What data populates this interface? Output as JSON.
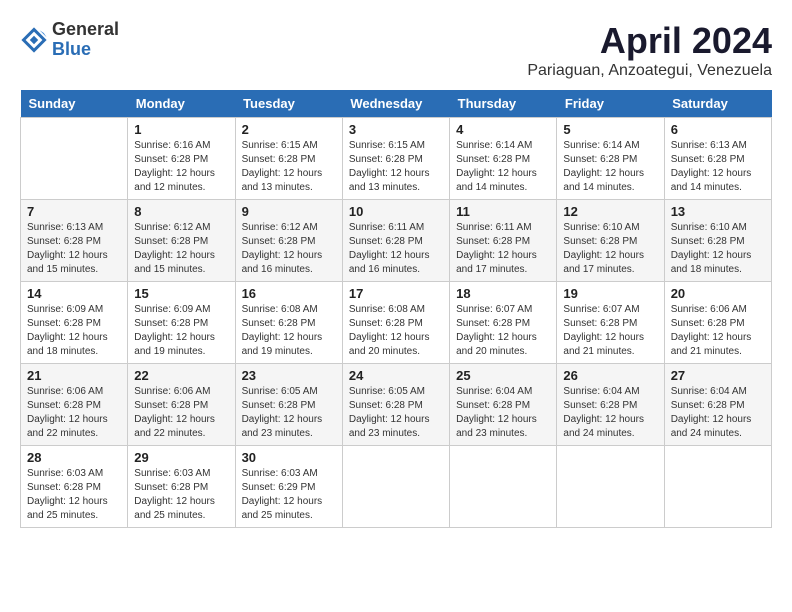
{
  "logo": {
    "general": "General",
    "blue": "Blue"
  },
  "title": "April 2024",
  "location": "Pariaguan, Anzoategui, Venezuela",
  "days_of_week": [
    "Sunday",
    "Monday",
    "Tuesday",
    "Wednesday",
    "Thursday",
    "Friday",
    "Saturday"
  ],
  "weeks": [
    [
      {
        "day": "",
        "info": ""
      },
      {
        "day": "1",
        "info": "Sunrise: 6:16 AM\nSunset: 6:28 PM\nDaylight: 12 hours\nand 12 minutes."
      },
      {
        "day": "2",
        "info": "Sunrise: 6:15 AM\nSunset: 6:28 PM\nDaylight: 12 hours\nand 13 minutes."
      },
      {
        "day": "3",
        "info": "Sunrise: 6:15 AM\nSunset: 6:28 PM\nDaylight: 12 hours\nand 13 minutes."
      },
      {
        "day": "4",
        "info": "Sunrise: 6:14 AM\nSunset: 6:28 PM\nDaylight: 12 hours\nand 14 minutes."
      },
      {
        "day": "5",
        "info": "Sunrise: 6:14 AM\nSunset: 6:28 PM\nDaylight: 12 hours\nand 14 minutes."
      },
      {
        "day": "6",
        "info": "Sunrise: 6:13 AM\nSunset: 6:28 PM\nDaylight: 12 hours\nand 14 minutes."
      }
    ],
    [
      {
        "day": "7",
        "info": "Sunrise: 6:13 AM\nSunset: 6:28 PM\nDaylight: 12 hours\nand 15 minutes."
      },
      {
        "day": "8",
        "info": "Sunrise: 6:12 AM\nSunset: 6:28 PM\nDaylight: 12 hours\nand 15 minutes."
      },
      {
        "day": "9",
        "info": "Sunrise: 6:12 AM\nSunset: 6:28 PM\nDaylight: 12 hours\nand 16 minutes."
      },
      {
        "day": "10",
        "info": "Sunrise: 6:11 AM\nSunset: 6:28 PM\nDaylight: 12 hours\nand 16 minutes."
      },
      {
        "day": "11",
        "info": "Sunrise: 6:11 AM\nSunset: 6:28 PM\nDaylight: 12 hours\nand 17 minutes."
      },
      {
        "day": "12",
        "info": "Sunrise: 6:10 AM\nSunset: 6:28 PM\nDaylight: 12 hours\nand 17 minutes."
      },
      {
        "day": "13",
        "info": "Sunrise: 6:10 AM\nSunset: 6:28 PM\nDaylight: 12 hours\nand 18 minutes."
      }
    ],
    [
      {
        "day": "14",
        "info": "Sunrise: 6:09 AM\nSunset: 6:28 PM\nDaylight: 12 hours\nand 18 minutes."
      },
      {
        "day": "15",
        "info": "Sunrise: 6:09 AM\nSunset: 6:28 PM\nDaylight: 12 hours\nand 19 minutes."
      },
      {
        "day": "16",
        "info": "Sunrise: 6:08 AM\nSunset: 6:28 PM\nDaylight: 12 hours\nand 19 minutes."
      },
      {
        "day": "17",
        "info": "Sunrise: 6:08 AM\nSunset: 6:28 PM\nDaylight: 12 hours\nand 20 minutes."
      },
      {
        "day": "18",
        "info": "Sunrise: 6:07 AM\nSunset: 6:28 PM\nDaylight: 12 hours\nand 20 minutes."
      },
      {
        "day": "19",
        "info": "Sunrise: 6:07 AM\nSunset: 6:28 PM\nDaylight: 12 hours\nand 21 minutes."
      },
      {
        "day": "20",
        "info": "Sunrise: 6:06 AM\nSunset: 6:28 PM\nDaylight: 12 hours\nand 21 minutes."
      }
    ],
    [
      {
        "day": "21",
        "info": "Sunrise: 6:06 AM\nSunset: 6:28 PM\nDaylight: 12 hours\nand 22 minutes."
      },
      {
        "day": "22",
        "info": "Sunrise: 6:06 AM\nSunset: 6:28 PM\nDaylight: 12 hours\nand 22 minutes."
      },
      {
        "day": "23",
        "info": "Sunrise: 6:05 AM\nSunset: 6:28 PM\nDaylight: 12 hours\nand 23 minutes."
      },
      {
        "day": "24",
        "info": "Sunrise: 6:05 AM\nSunset: 6:28 PM\nDaylight: 12 hours\nand 23 minutes."
      },
      {
        "day": "25",
        "info": "Sunrise: 6:04 AM\nSunset: 6:28 PM\nDaylight: 12 hours\nand 23 minutes."
      },
      {
        "day": "26",
        "info": "Sunrise: 6:04 AM\nSunset: 6:28 PM\nDaylight: 12 hours\nand 24 minutes."
      },
      {
        "day": "27",
        "info": "Sunrise: 6:04 AM\nSunset: 6:28 PM\nDaylight: 12 hours\nand 24 minutes."
      }
    ],
    [
      {
        "day": "28",
        "info": "Sunrise: 6:03 AM\nSunset: 6:28 PM\nDaylight: 12 hours\nand 25 minutes."
      },
      {
        "day": "29",
        "info": "Sunrise: 6:03 AM\nSunset: 6:28 PM\nDaylight: 12 hours\nand 25 minutes."
      },
      {
        "day": "30",
        "info": "Sunrise: 6:03 AM\nSunset: 6:29 PM\nDaylight: 12 hours\nand 25 minutes."
      },
      {
        "day": "",
        "info": ""
      },
      {
        "day": "",
        "info": ""
      },
      {
        "day": "",
        "info": ""
      },
      {
        "day": "",
        "info": ""
      }
    ]
  ]
}
